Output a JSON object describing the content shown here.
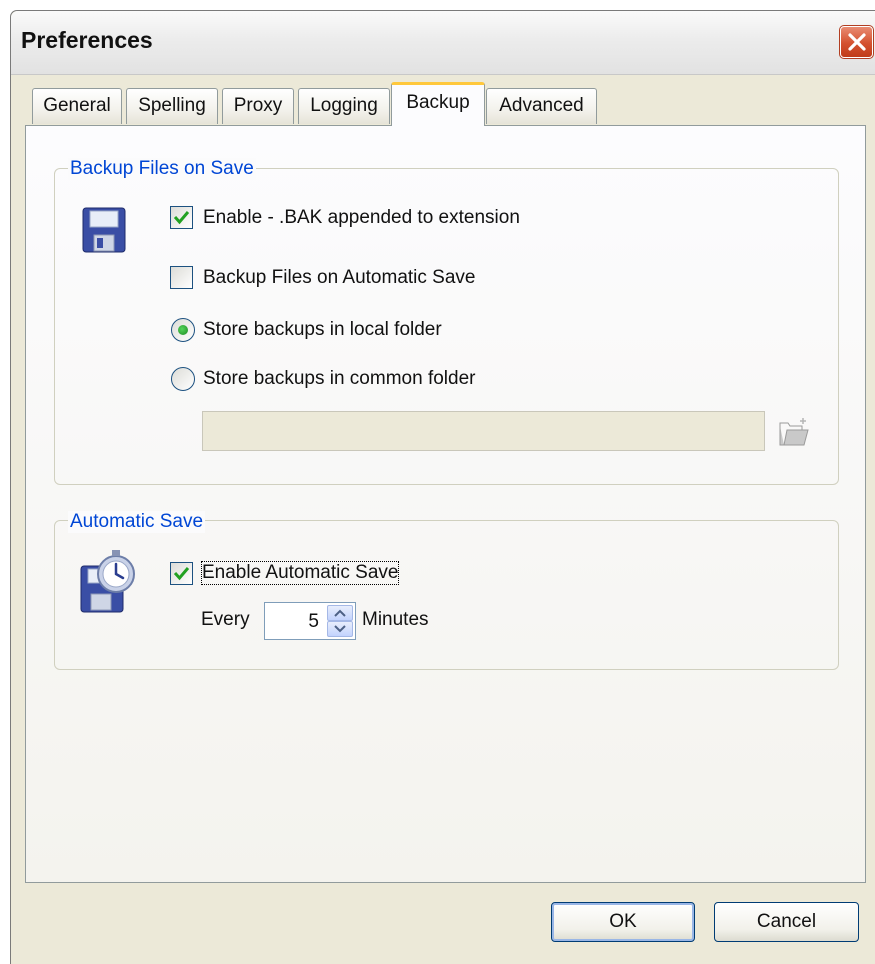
{
  "window": {
    "title": "Preferences"
  },
  "tabs": [
    {
      "label": "General",
      "active": false
    },
    {
      "label": "Spelling",
      "active": false
    },
    {
      "label": "Proxy",
      "active": false
    },
    {
      "label": "Logging",
      "active": false
    },
    {
      "label": "Backup",
      "active": true
    },
    {
      "label": "Advanced",
      "active": false
    }
  ],
  "backup_group": {
    "title": "Backup Files on Save",
    "icon": "floppy-disk-icon",
    "enable_label": "Enable - .BAK appended to extension",
    "enable_checked": true,
    "auto_save_backup_label": "Backup Files on Automatic Save",
    "auto_save_backup_checked": false,
    "local_folder_label": "Store backups in local folder",
    "local_folder_selected": true,
    "common_folder_label": "Store backups in common folder",
    "common_folder_selected": false,
    "folder_path_value": "",
    "browse_icon": "folder-open-icon"
  },
  "autosave_group": {
    "title": "Automatic Save",
    "icon": "floppy-stopwatch-icon",
    "enable_label": "Enable Automatic Save",
    "enable_checked": true,
    "every_label": "Every",
    "interval_value": "5",
    "minutes_label": "Minutes"
  },
  "buttons": {
    "ok": "OK",
    "cancel": "Cancel"
  },
  "colors": {
    "group_title": "#0046d5",
    "check_mark": "#21a121",
    "active_tab_accent": "#ffc83c"
  }
}
